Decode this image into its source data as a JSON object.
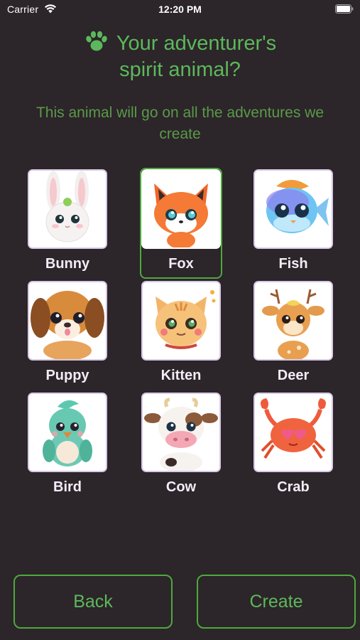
{
  "status_bar": {
    "carrier": "Carrier",
    "time": "12:20 PM",
    "wifi_icon": "wifi-icon",
    "battery_icon": "battery-icon"
  },
  "header": {
    "title_line1": "Your adventurer's",
    "title_line2": "spirit animal?",
    "icon": "paw-icon",
    "subtitle": "This animal will go on all the adventures we create"
  },
  "animals": [
    {
      "label": "Bunny",
      "selected": false
    },
    {
      "label": "Fox",
      "selected": true
    },
    {
      "label": "Fish",
      "selected": false
    },
    {
      "label": "Puppy",
      "selected": false
    },
    {
      "label": "Kitten",
      "selected": false
    },
    {
      "label": "Deer",
      "selected": false
    },
    {
      "label": "Bird",
      "selected": false
    },
    {
      "label": "Cow",
      "selected": false
    },
    {
      "label": "Crab",
      "selected": false
    }
  ],
  "actions": {
    "back_label": "Back",
    "create_label": "Create"
  },
  "colors": {
    "background": "#2c2529",
    "accent": "#5cb85c",
    "selected_border": "#4caa3c",
    "tile_border": "#d7c9e6"
  }
}
